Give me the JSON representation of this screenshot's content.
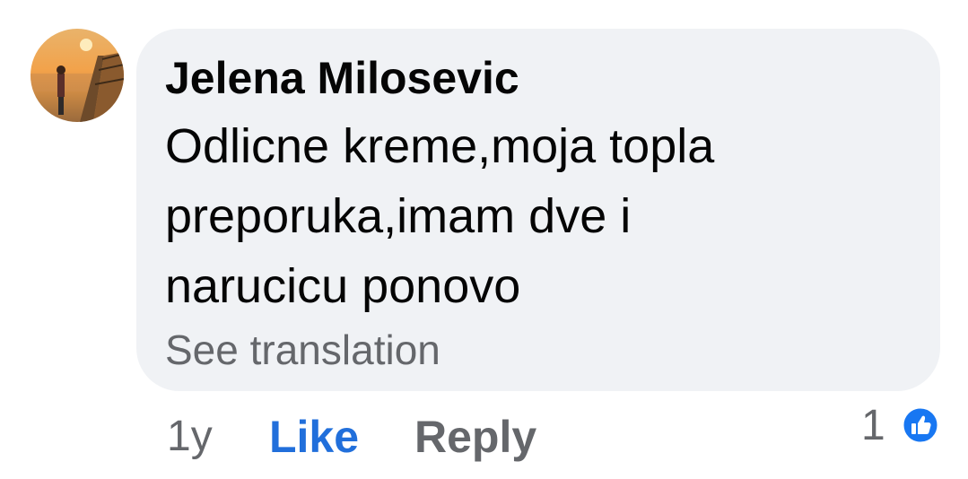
{
  "comment": {
    "author": "Jelena Milosevic",
    "text_lines": [
      "Odlicne kreme,moja topla",
      "preporuka,imam dve i",
      "narucicu ponovo"
    ],
    "see_translation": "See translation",
    "age": "1y",
    "like_label": "Like",
    "reply_label": "Reply",
    "reaction_count": "1",
    "reaction_icon": "like-thumb-icon",
    "colors": {
      "bubble": "#f0f2f5",
      "like": "#216fdb",
      "secondary": "#65676b",
      "text": "#050505"
    }
  }
}
